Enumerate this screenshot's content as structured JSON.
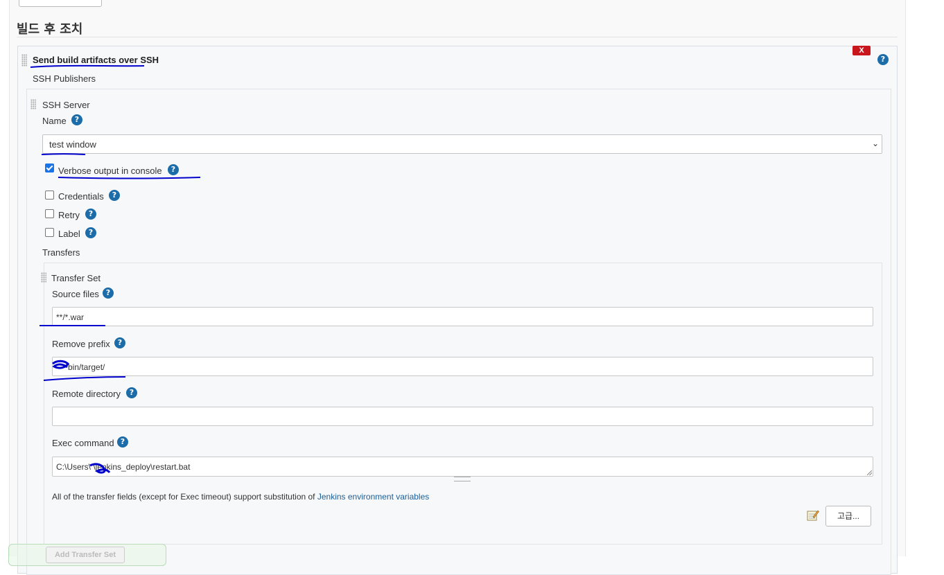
{
  "section": {
    "title": "빌드 후 조치"
  },
  "publisher": {
    "title": "Send build artifacts over SSH",
    "delete_label": "X",
    "ssh_publishers_label": "SSH Publishers"
  },
  "server": {
    "heading": "SSH Server",
    "name_label": "Name",
    "name_value": "test window",
    "options": [
      {
        "label": "Verbose output in console",
        "checked": true
      },
      {
        "label": "Credentials",
        "checked": false
      },
      {
        "label": "Retry",
        "checked": false
      },
      {
        "label": "Label",
        "checked": false
      }
    ],
    "transfers_label": "Transfers"
  },
  "transfer_set": {
    "heading": "Transfer Set",
    "source_files_label": "Source files",
    "source_files_value": "**/*.war",
    "remove_prefix_label": "Remove prefix",
    "remove_prefix_value": "bin/target/",
    "remote_directory_label": "Remote directory",
    "remote_directory_value": "",
    "exec_command_label": "Exec command",
    "exec_command_value": "C:\\Users\\  \\jenkins_deploy\\restart.bat",
    "note_text": "All of the transfer fields (except for Exec timeout) support substitution of ",
    "note_link": "Jenkins environment variables",
    "advanced_label": "고급...",
    "add_transfer_label": "Add Transfer Set"
  },
  "help_glyph": "?",
  "colors": {
    "help_icon": "#1b6ca8",
    "delete_button": "#c9161c",
    "annotation_ink": "#0000cc",
    "link": "#1b5e99"
  }
}
